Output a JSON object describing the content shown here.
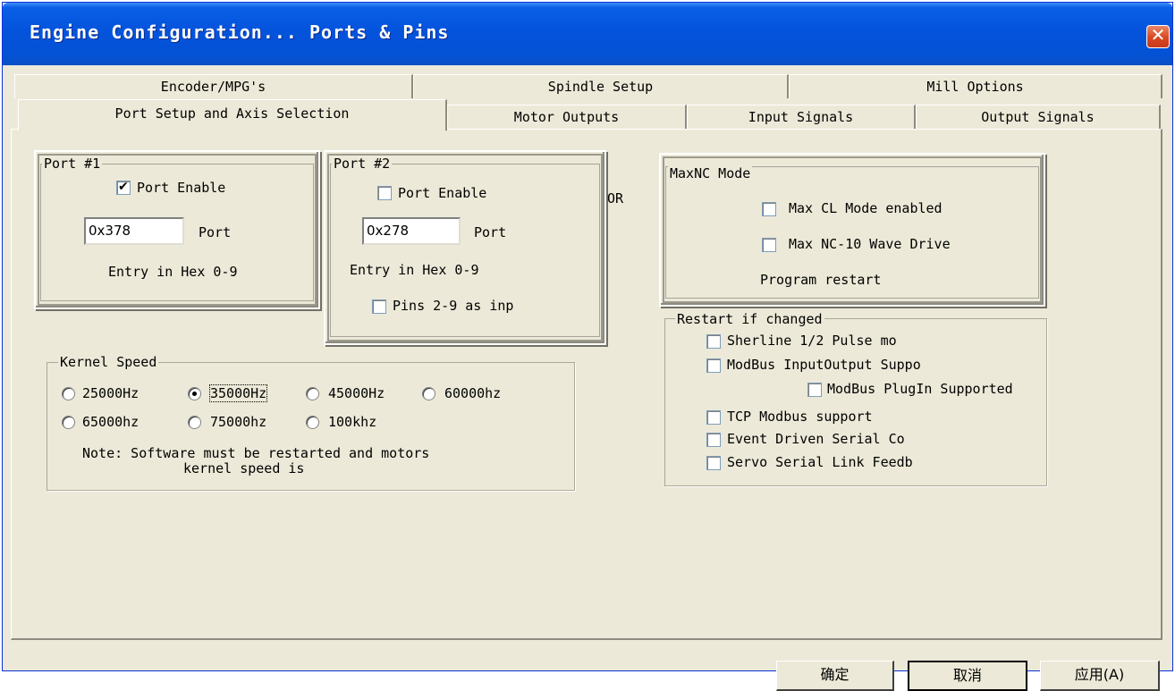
{
  "window": {
    "title": "Engine Configuration... Ports & Pins"
  },
  "tabs": {
    "back_row": [
      {
        "label": "Encoder/MPG's"
      },
      {
        "label": "Spindle Setup"
      },
      {
        "label": "Mill Options"
      }
    ],
    "front_row": [
      {
        "label": "Port Setup and Axis Selection",
        "active": true
      },
      {
        "label": "Motor Outputs"
      },
      {
        "label": "Input Signals"
      },
      {
        "label": "Output Signals"
      }
    ]
  },
  "port1": {
    "legend": "Port #1",
    "enable_label": "Port Enable",
    "enabled": true,
    "address": "0x378",
    "address_label": "Port",
    "hint": "Entry in Hex 0-9"
  },
  "port2": {
    "legend": "Port #2",
    "enable_label": "Port Enable",
    "enabled": false,
    "address": "0x278",
    "address_label": "Port",
    "hint": "Entry in Hex 0-9",
    "pins_label": "Pins 2-9 as inp",
    "pins_checked": false
  },
  "or_label": "OR",
  "kernel": {
    "legend": "Kernel Speed",
    "options": [
      "25000Hz",
      "35000Hz",
      "45000Hz",
      "60000hz",
      "65000hz",
      "75000hz",
      "100khz"
    ],
    "selected": "35000Hz",
    "note_line1": "Note: Software must be restarted and motors",
    "note_line2": "kernel speed is"
  },
  "maxnc": {
    "legend": "MaxNC Mode",
    "cl_label": "Max CL Mode enabled",
    "wave_label": "Max NC-10 Wave Drive",
    "restart_note": "Program restart"
  },
  "restart": {
    "legend": "Restart if changed",
    "items": [
      "Sherline 1/2 Pulse mo",
      "ModBus InputOutput Suppo",
      "ModBus PlugIn Supported",
      "TCP Modbus support",
      "Event Driven Serial Co",
      "Servo Serial Link Feedb"
    ]
  },
  "buttons": {
    "ok": "确定",
    "cancel": "取消",
    "apply": "应用(A)"
  }
}
